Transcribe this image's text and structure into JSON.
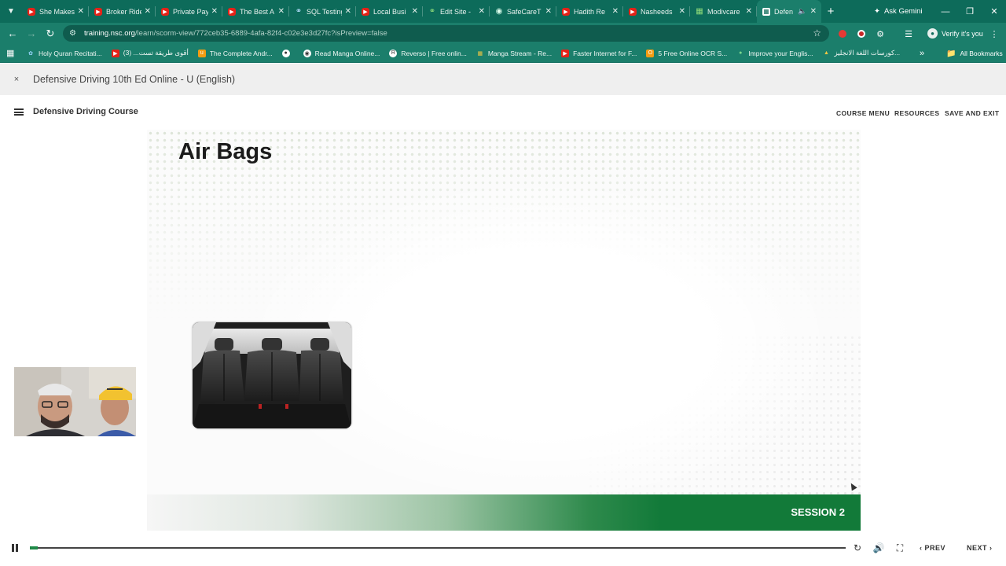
{
  "browser": {
    "tabs": [
      {
        "title": "She Makes",
        "favicon": "youtube-icon"
      },
      {
        "title": "Broker Ride",
        "favicon": "youtube-icon"
      },
      {
        "title": "Private Pay",
        "favicon": "youtube-icon"
      },
      {
        "title": "The Best A",
        "favicon": "youtube-icon"
      },
      {
        "title": "SQL Testing",
        "favicon": "sql-icon"
      },
      {
        "title": "Local Busi",
        "favicon": "youtube-icon"
      },
      {
        "title": "Edit Site -",
        "favicon": "wordpress-icon"
      },
      {
        "title": "SafeCareT",
        "favicon": "globe-icon"
      },
      {
        "title": "Hadith Re",
        "favicon": "youtube-icon"
      },
      {
        "title": "Nasheeds",
        "favicon": "youtube-icon"
      },
      {
        "title": "Modivcare",
        "favicon": "grid-icon"
      },
      {
        "title": "Defen",
        "favicon": "table-icon",
        "active": true
      }
    ],
    "gemini_label": "Ask Gemini",
    "url_host": "training.nsc.org",
    "url_path": "/learn/scorm-view/772ceb35-6889-4afa-82f4-c02e3e3d27fc?isPreview=false",
    "profile_label": "Verify it's you",
    "bookmarks": [
      {
        "label": "Holy Quran Recitati...",
        "icon": "feather-icon"
      },
      {
        "label": "أقوى طريقة تست... (3)",
        "icon": "youtube-icon"
      },
      {
        "label": "The Complete Andr...",
        "icon": "udemy-icon"
      },
      {
        "label": "",
        "icon": "github-icon"
      },
      {
        "label": "Read Manga Online...",
        "icon": "globe-icon"
      },
      {
        "label": "Reverso | Free onlin...",
        "icon": "reverso-icon"
      },
      {
        "label": "Manga Stream - Re...",
        "icon": "manga-icon"
      },
      {
        "label": "Faster Internet for F...",
        "icon": "youtube-icon"
      },
      {
        "label": "5 Free Online OCR S...",
        "icon": "ocr-icon"
      },
      {
        "label": "Improve your Englis...",
        "icon": "book-icon"
      },
      {
        "label": "كورسات اللغة الانجليز...",
        "icon": "drive-icon"
      }
    ],
    "all_bookmarks_label": "All Bookmarks"
  },
  "doc_bar": {
    "close_label": "×",
    "title": "Defensive Driving 10th Ed Online - U (English)"
  },
  "course_header": {
    "title": "Defensive Driving Course",
    "links": [
      "COURSE MENU",
      "RESOURCES",
      "SAVE AND EXIT"
    ]
  },
  "slide": {
    "title": "Air Bags",
    "session_label": "SESSION 2",
    "image_subject": "car rear seat interior",
    "accent_color": "#127a39"
  },
  "player": {
    "progress_fraction": 0.01,
    "prev_label": "PREV",
    "next_label": "NEXT"
  }
}
